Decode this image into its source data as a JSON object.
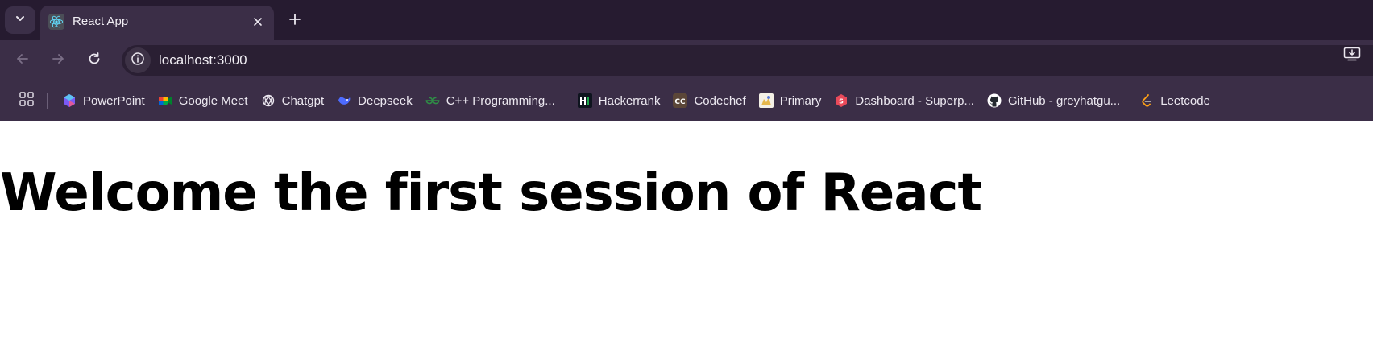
{
  "tab": {
    "title": "React App",
    "favicon": "react-icon"
  },
  "toolbar": {
    "url": "localhost:3000"
  },
  "bookmarks": [
    {
      "label": "PowerPoint",
      "icon": "powerpoint-icon"
    },
    {
      "label": "Google Meet",
      "icon": "google-meet-icon"
    },
    {
      "label": "Chatgpt",
      "icon": "chatgpt-icon"
    },
    {
      "label": "Deepseek",
      "icon": "deepseek-icon"
    },
    {
      "label": "C++ Programming...",
      "icon": "geeksforgeeks-icon"
    },
    {
      "label": "Hackerrank",
      "icon": "hackerrank-icon"
    },
    {
      "label": "Codechef",
      "icon": "codechef-icon"
    },
    {
      "label": "Primary",
      "icon": "primary-icon"
    },
    {
      "label": "Dashboard - Superp...",
      "icon": "superprof-icon"
    },
    {
      "label": "GitHub - greyhatgu...",
      "icon": "github-icon"
    },
    {
      "label": "Leetcode",
      "icon": "leetcode-icon"
    }
  ],
  "page": {
    "heading": "Welcome the first session of React"
  },
  "colors": {
    "titlebar": "#261b30",
    "toolbar": "#3b2e47",
    "omnibox": "#2a1f33",
    "page_background": "#ffffff",
    "heading": "#000000"
  }
}
